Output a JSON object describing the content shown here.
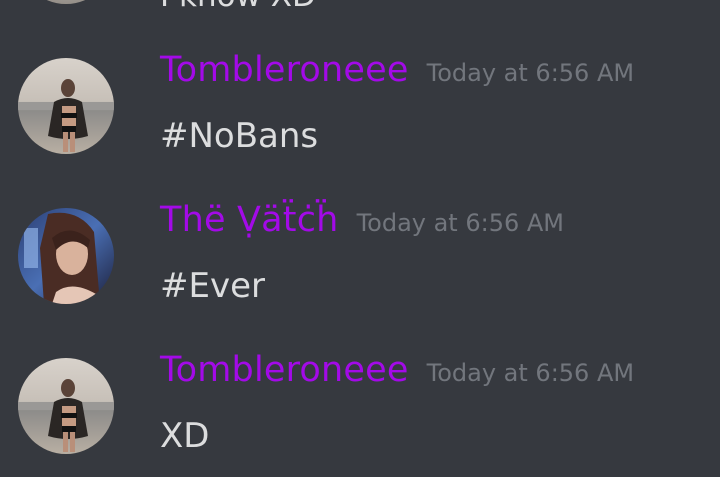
{
  "previous_message": {
    "text": "I know XD"
  },
  "messages": [
    {
      "username": "Tombleroneee",
      "timestamp": "Today at 6:56 AM",
      "content": "#NoBans",
      "avatar_icon": "beach-photo-avatar"
    },
    {
      "username": "Thë Ṿäẗċḧ",
      "timestamp": "Today at 6:56 AM",
      "content": "#Ever",
      "avatar_icon": "portrait-photo-avatar"
    },
    {
      "username": "Tombleroneee",
      "timestamp": "Today at 6:56 AM",
      "content": "XD",
      "avatar_icon": "beach-photo-avatar"
    }
  ],
  "colors": {
    "background": "#36393f",
    "username": "#a30ae8",
    "timestamp": "#72767d",
    "message_text": "#dcddde"
  }
}
